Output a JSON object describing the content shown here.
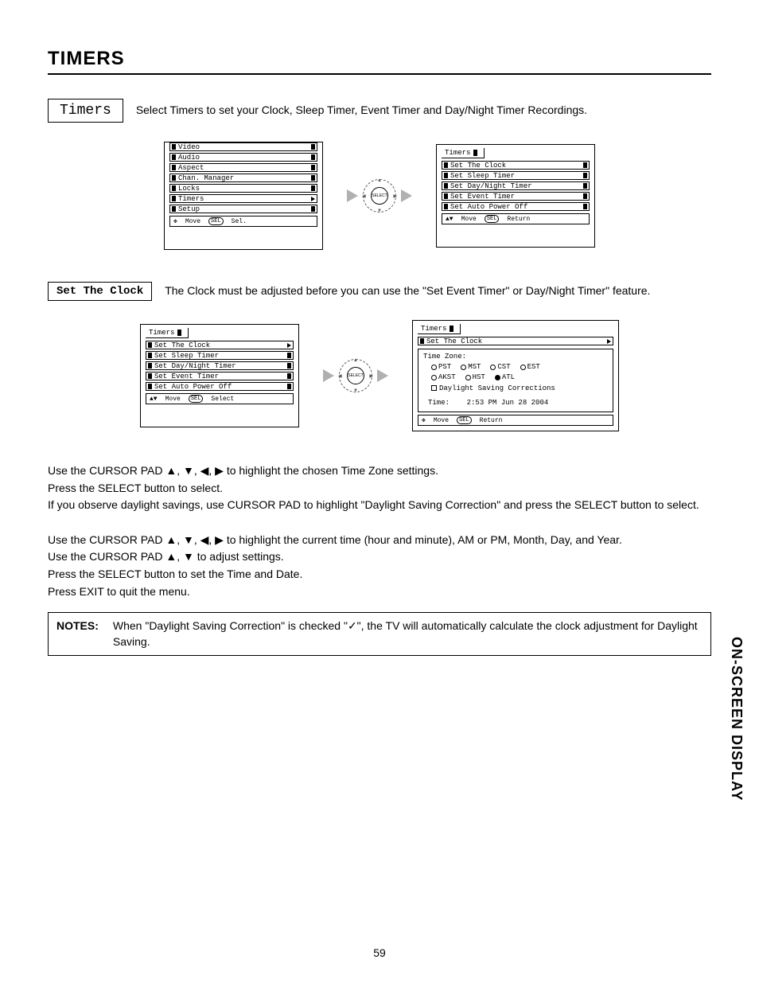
{
  "page": {
    "title": "TIMERS",
    "number": "59",
    "side_tab": "ON-SCREEN DISPLAY"
  },
  "timers_section": {
    "label": "Timers",
    "description": "Select Timers to set your Clock, Sleep Timer, Event Timer and Day/Night Timer Recordings."
  },
  "main_menu": {
    "items": [
      "Video",
      "Audio",
      "Aspect",
      "Chan. Manager",
      "Locks",
      "Timers",
      "Setup"
    ],
    "selected_index": 5,
    "footer_move": "Move",
    "footer_sel_badge": "SEL",
    "footer_sel_text": "Sel."
  },
  "select_button_label": "SELECT",
  "timers_menu": {
    "title": "Timers",
    "items": [
      "Set The Clock",
      "Set Sleep Timer",
      "Set Day/Night Timer",
      "Set Event Timer",
      "Set Auto Power Off"
    ],
    "footer_move": "Move",
    "footer_sel_badge": "SEL",
    "footer_return": "Return"
  },
  "set_clock_section": {
    "label": "Set The Clock",
    "description": "The Clock must be adjusted before you can use the \"Set Event Timer\" or Day/Night Timer\" feature."
  },
  "timers_menu2": {
    "title": "Timers",
    "items": [
      "Set The Clock",
      "Set Sleep Timer",
      "Set Day/Night Timer",
      "Set Event Timer",
      "Set Auto Power Off"
    ],
    "selected_index": 0,
    "footer_move": "Move",
    "footer_sel_badge": "SEL",
    "footer_select": "Select"
  },
  "clock_detail": {
    "title": "Timers",
    "subtitle": "Set The Clock",
    "tz_label": "Time Zone:",
    "tz_row1": [
      "PST",
      "MST",
      "CST",
      "EST"
    ],
    "tz_row2": [
      "AKST",
      "HST",
      "ATL"
    ],
    "tz_selected": "ATL",
    "daylight_label": "Daylight Saving Corrections",
    "time_label": "Time:",
    "time_value": "2:53 PM Jun 28 2004",
    "footer_move": "Move",
    "footer_sel_badge": "SEL",
    "footer_return": "Return"
  },
  "instructions": {
    "p1a": "Use the CURSOR PAD ",
    "p1b": " to highlight the chosen Time Zone settings.",
    "p2": "Press the SELECT button to select.",
    "p3": "If you observe daylight savings, use CURSOR PAD to highlight \"Daylight Saving Correction\" and press the SELECT button to select.",
    "p4a": "Use the CURSOR PAD ",
    "p4b": " to highlight the current time (hour and minute), AM or PM, Month, Day, and Year.",
    "p5a": "Use the CURSOR PAD ",
    "p5b": " to adjust settings.",
    "p6": "Press the SELECT button to set the Time and Date.",
    "p7": "Press EXIT to quit the menu."
  },
  "notes": {
    "label": "NOTES:",
    "text_a": "When \"Daylight Saving Correction\" is checked \"",
    "check_glyph": "✓",
    "text_b": "\", the TV will automatically calculate the clock adjustment for Daylight Saving."
  },
  "glyphs": {
    "up": "▲",
    "down": "▼",
    "left": "◀",
    "right": "▶",
    "updown": "▲▼",
    "all4": "▲, ▼, ◀, ▶",
    "twodir": "▲, ▼",
    "cross": "✥"
  }
}
